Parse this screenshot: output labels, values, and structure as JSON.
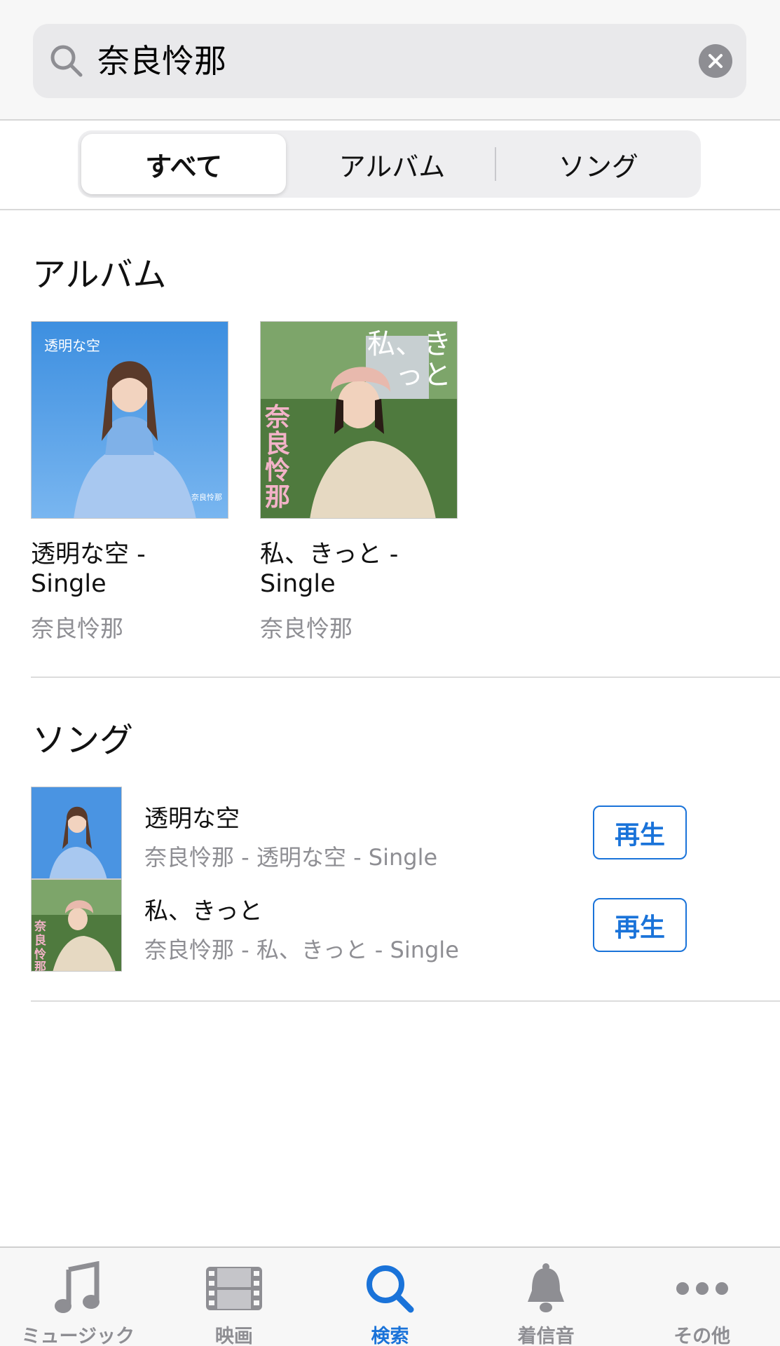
{
  "search": {
    "query": "奈良怜那",
    "icon": "search-icon",
    "clear_icon": "clear-icon"
  },
  "segments": [
    {
      "label": "すべて",
      "selected": true
    },
    {
      "label": "アルバム",
      "selected": false
    },
    {
      "label": "ソング",
      "selected": false
    }
  ],
  "albums_section": {
    "title": "アルバム",
    "items": [
      {
        "title": "透明な空 - Single",
        "artist": "奈良怜那",
        "art_text": "透明な空",
        "art_small": "奈良怜那"
      },
      {
        "title_line1": "私、きっと -",
        "title_line2": "Single",
        "artist": "奈良怜那",
        "art_text": "私、きっと",
        "art_side": "奈良怜那"
      }
    ]
  },
  "songs_section": {
    "title": "ソング",
    "items": [
      {
        "title": "透明な空",
        "subtitle": "奈良怜那 - 透明な空 - Single",
        "button": "再生"
      },
      {
        "title": "私、きっと",
        "subtitle": "奈良怜那 - 私、きっと - Single",
        "button": "再生"
      }
    ]
  },
  "tabbar": {
    "tabs": [
      {
        "label": "ミュージック",
        "icon": "music-note-icon",
        "active": false
      },
      {
        "label": "映画",
        "icon": "film-icon",
        "active": false
      },
      {
        "label": "検索",
        "icon": "search-icon",
        "active": true
      },
      {
        "label": "着信音",
        "icon": "bell-icon",
        "active": false
      },
      {
        "label": "その他",
        "icon": "more-icon",
        "active": false
      }
    ]
  },
  "colors": {
    "accent": "#1a73d9",
    "secondary_text": "#8e8e93"
  }
}
